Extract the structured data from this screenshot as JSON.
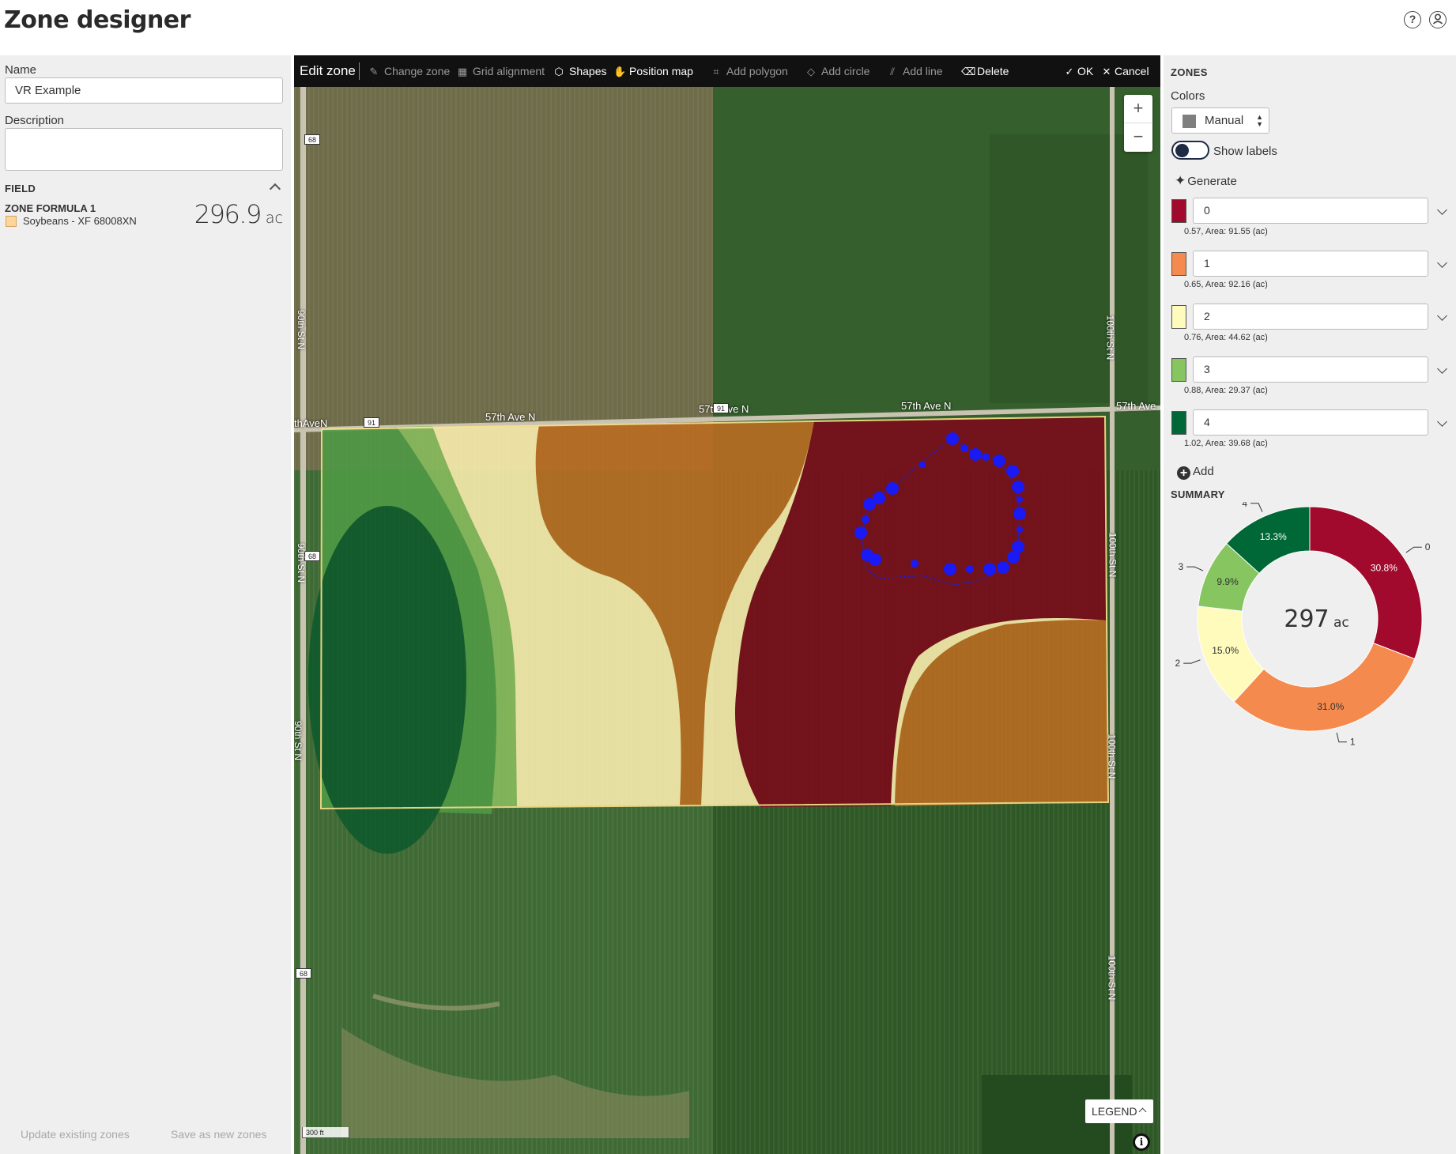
{
  "header": {
    "title": "Zone designer",
    "help_icon": "help-circle-icon",
    "account_icon": "user-account-icon"
  },
  "left_panel": {
    "name_label": "Name",
    "name_value": "VR Example",
    "description_label": "Description",
    "description_value": "",
    "field_section": "FIELD",
    "zone_formula": "ZONE FORMULA 1",
    "crop": "Soybeans - XF 68008XN",
    "area_value": "296.9",
    "area_unit": "ac",
    "update_button": "Update existing zones",
    "save_new_button": "Save as new zones"
  },
  "toolbar": {
    "title": "Edit zone",
    "change_zone": "Change zone",
    "grid_alignment": "Grid alignment",
    "shapes": "Shapes",
    "position_map": "Position map",
    "add_polygon": "Add polygon",
    "add_circle": "Add circle",
    "add_line": "Add line",
    "delete": "Delete",
    "ok": "OK",
    "cancel": "Cancel"
  },
  "map": {
    "zoom_in": "+",
    "zoom_out": "−",
    "legend": "LEGEND",
    "scale": "300 ft",
    "info": "i",
    "road_labels": {
      "ave_left": "thAveN",
      "ave_1": "57th Ave N",
      "ave_2": "57th Ave N",
      "ave_3": "57th Ave N",
      "ave_right": "57th Ave",
      "shield_91": "91",
      "shield_68": "68",
      "st_90": "90th St N",
      "st_100": "100th St N"
    }
  },
  "zones_panel": {
    "title": "ZONES",
    "colors_label": "Colors",
    "colors_value": "Manual",
    "show_labels": "Show labels",
    "generate": "Generate",
    "add": "Add",
    "summary": "SUMMARY",
    "zones": [
      {
        "name": "0",
        "detail": "0.57, Area: 91.55 (ac)",
        "color": "#a10a2c"
      },
      {
        "name": "1",
        "detail": "0.65, Area: 92.16 (ac)",
        "color": "#f58a4e"
      },
      {
        "name": "2",
        "detail": "0.76, Area: 44.62 (ac)",
        "color": "#fffbbd"
      },
      {
        "name": "3",
        "detail": "0.88, Area: 29.37 (ac)",
        "color": "#86c55f"
      },
      {
        "name": "4",
        "detail": "1.02, Area: 39.68 (ac)",
        "color": "#006837"
      }
    ]
  },
  "chart_data": {
    "type": "pie",
    "center_value": "297",
    "center_unit": "ac",
    "slices": [
      {
        "label": "0",
        "percent": 30.8,
        "percent_label": "30.8%",
        "color": "#a10a2c"
      },
      {
        "label": "1",
        "percent": 31.0,
        "percent_label": "31.0%",
        "color": "#f58a4e"
      },
      {
        "label": "2",
        "percent": 15.0,
        "percent_label": "15.0%",
        "color": "#fffbbd"
      },
      {
        "label": "3",
        "percent": 9.9,
        "percent_label": "9.9%",
        "color": "#86c55f"
      },
      {
        "label": "4",
        "percent": 13.3,
        "percent_label": "13.3%",
        "color": "#006837"
      }
    ]
  }
}
